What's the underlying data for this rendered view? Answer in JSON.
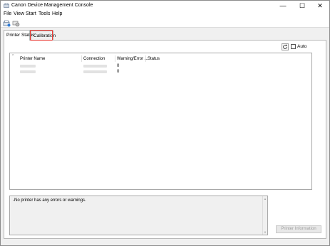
{
  "window": {
    "title": "Canon Device Management Console",
    "controls": [
      "—",
      "☐",
      "✕"
    ]
  },
  "menu": {
    "items": [
      "File",
      "View",
      "Start",
      "Tools",
      "Help"
    ]
  },
  "toolbar": {
    "icons": [
      "add-printer-icon",
      "printer-settings-icon"
    ]
  },
  "tabs": [
    {
      "label": "Printer Status",
      "active": true
    },
    {
      "label": "Calibration",
      "active": false
    }
  ],
  "panel": {
    "auto_label": "Auto",
    "auto_checked": false,
    "columns": [
      "Printer Name",
      "Connection",
      "Warning/Error ...",
      "Status"
    ],
    "rows": [
      {
        "printer_name": "",
        "connection": "",
        "warnings": "0",
        "status": ""
      },
      {
        "printer_name": "",
        "connection": "",
        "warnings": "0",
        "status": ""
      }
    ],
    "message": "-No printer has any errors or warnings.",
    "info_button": "Printer Information"
  },
  "colors": {
    "highlight": "#e8312a",
    "window_bg": "#f0f0f0"
  }
}
